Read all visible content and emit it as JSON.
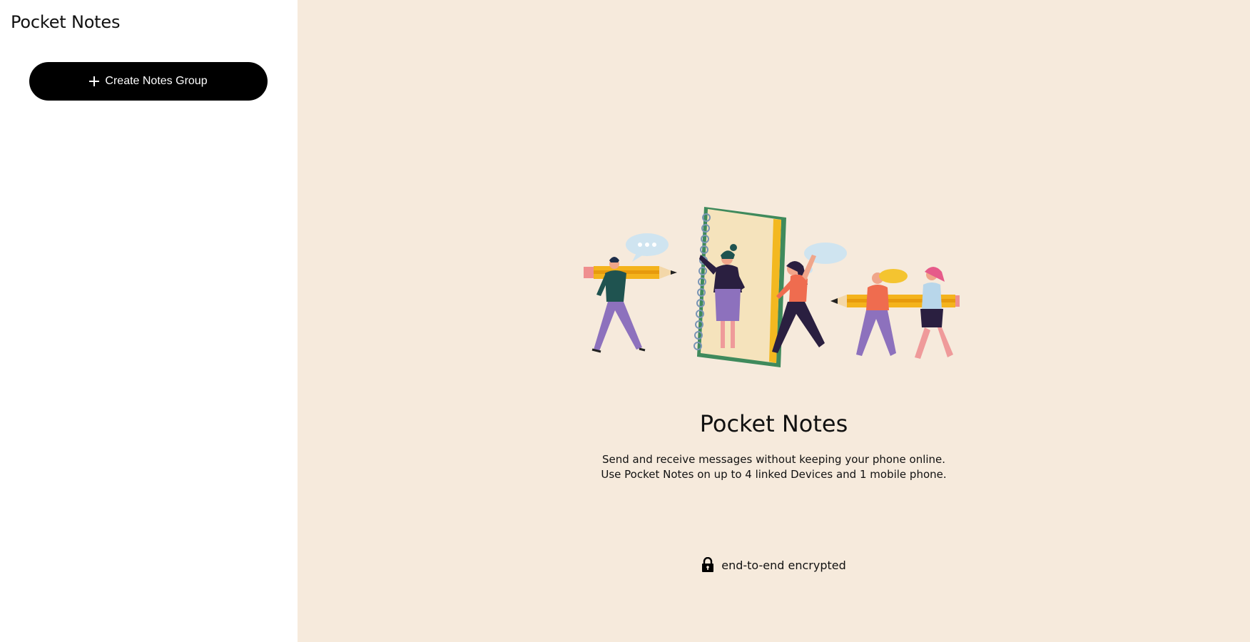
{
  "sidebar": {
    "title": "Pocket Notes",
    "create_button_label": "Create Notes Group",
    "create_button_icon": "plus-icon"
  },
  "main": {
    "title": "Pocket Notes",
    "description_lines": [
      "Send and receive messages without keeping your phone online.",
      "Use Pocket Notes on up to 4 linked Devices and 1 mobile phone."
    ],
    "footer_icon": "lock-icon",
    "footer_text": "end-to-end encrypted"
  },
  "colors": {
    "main_background": "#f6eadc",
    "button_background": "#000000",
    "button_text": "#ffffff"
  }
}
